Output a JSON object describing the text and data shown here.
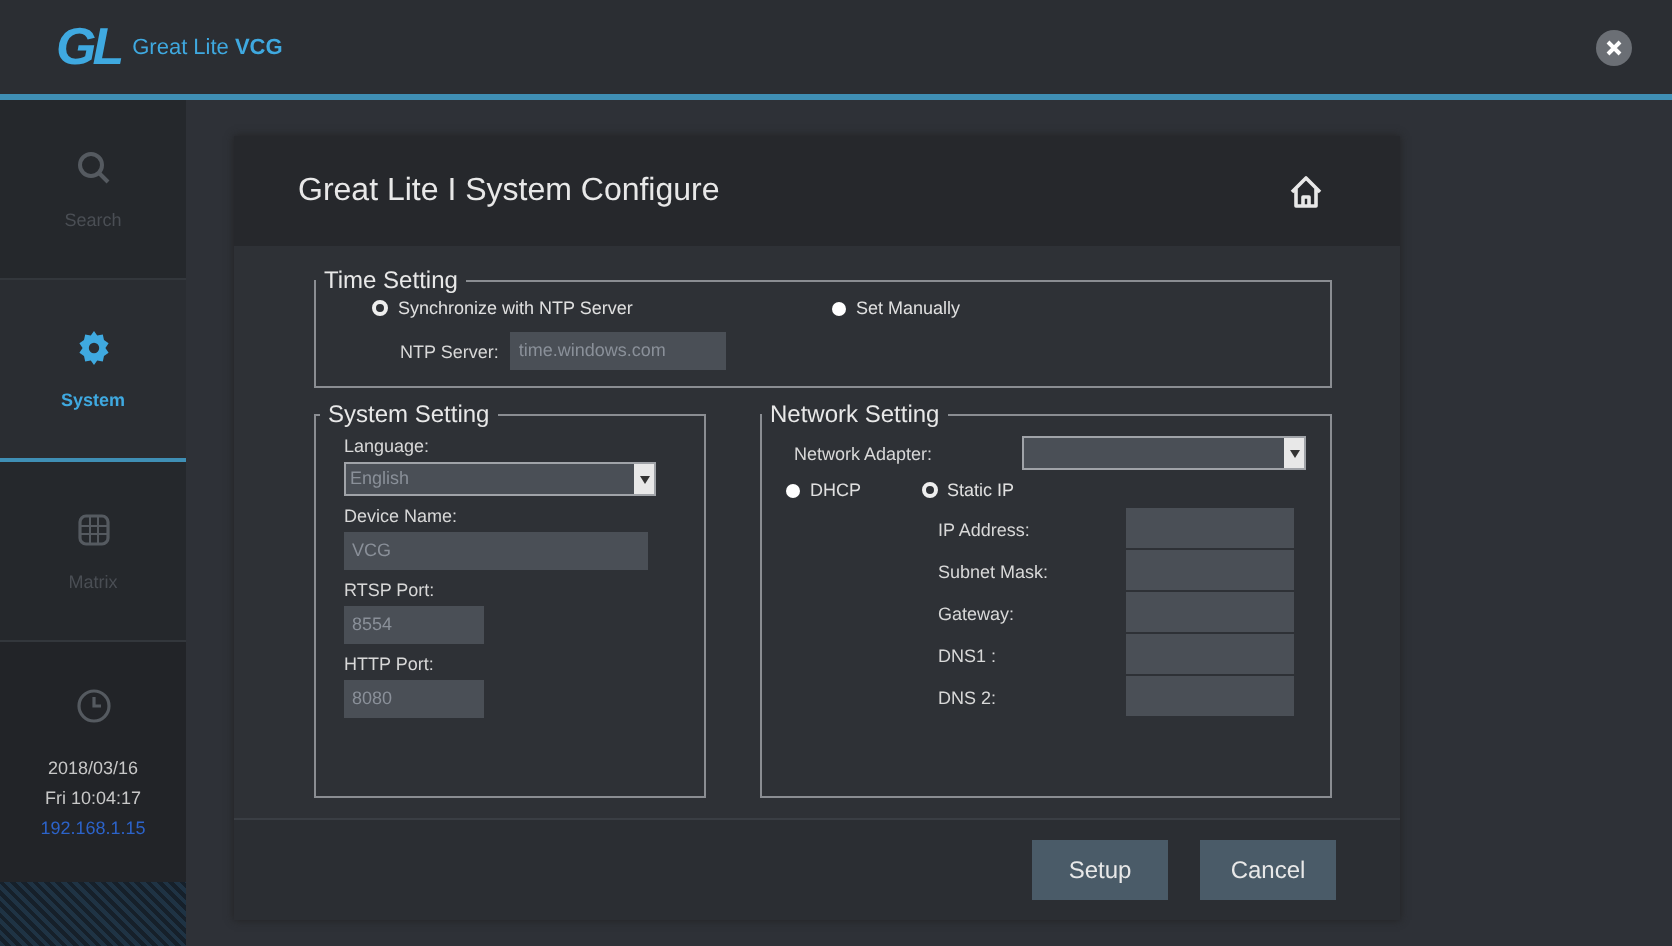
{
  "app": {
    "logo": "GL",
    "title": "Great Lite **VCG**"
  },
  "sidebar": {
    "items": [
      {
        "kind": "search",
        "label": "Search",
        "selected": false
      },
      {
        "kind": "gear",
        "label": "System",
        "selected": true
      },
      {
        "kind": "grid",
        "label": "Matrix",
        "selected": false
      }
    ],
    "clock": {
      "date": "2018/03/16",
      "time": "Fri 10:04:17",
      "ip": "192.168.1.15"
    }
  },
  "dialog": {
    "title": "Great Lite I System Configure",
    "time_setting": {
      "title": "Time Setting",
      "options": [
        {
          "label": "Synchronize with NTP Server",
          "selected": true
        },
        {
          "label": "Set Manually",
          "selected": false
        }
      ],
      "ntp": {
        "label": "NTP Server:",
        "value": "time.windows.com"
      }
    },
    "system_setting": {
      "title": "System Setting",
      "fields": [
        {
          "kind": "select",
          "label": "Language:",
          "value": "English"
        },
        {
          "kind": "text",
          "label": "Device Name:",
          "value": "VCG"
        },
        {
          "kind": "port",
          "label": "RTSP Port:",
          "value": "8554"
        },
        {
          "kind": "port",
          "label": "HTTP Port:",
          "value": "8080"
        }
      ]
    },
    "network_setting": {
      "title": "Network Setting",
      "adapter_label": "Network Adapter:",
      "modes": [
        {
          "label": "DHCP",
          "selected": false
        },
        {
          "label": "Static IP",
          "selected": true
        }
      ],
      "fields": [
        {
          "label": "IP Address:"
        },
        {
          "label": "Subnet Mask:"
        },
        {
          "label": "Gateway:"
        },
        {
          "label": "DNS1 :"
        },
        {
          "label": "DNS 2:"
        }
      ]
    },
    "buttons": [
      "Setup",
      "Cancel"
    ]
  }
}
